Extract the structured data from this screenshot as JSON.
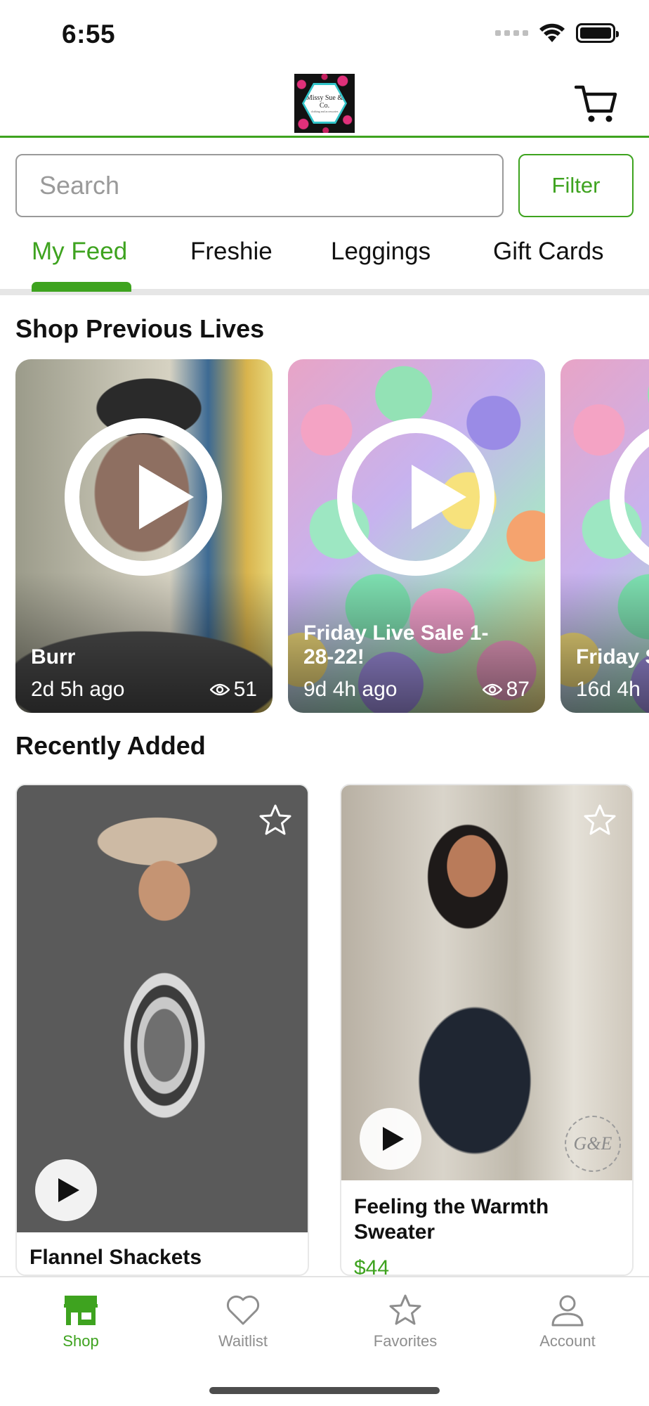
{
  "status_bar": {
    "time": "6:55"
  },
  "header": {
    "logo_text": "Missy Sue & Co.",
    "logo_subtext": "clothing and accessories"
  },
  "search": {
    "placeholder": "Search",
    "value": ""
  },
  "filter_label": "Filter",
  "tabs": [
    {
      "label": "My Feed",
      "active": true
    },
    {
      "label": "Freshie",
      "active": false
    },
    {
      "label": "Leggings",
      "active": false
    },
    {
      "label": "Gift Cards",
      "active": false
    }
  ],
  "previous_lives": {
    "title": "Shop Previous Lives",
    "items": [
      {
        "title": "Burr",
        "time_ago": "2d 5h ago",
        "views": "51"
      },
      {
        "title": "Friday Live Sale 1-28-22!",
        "time_ago": "9d 4h ago",
        "views": "87"
      },
      {
        "title": "Friday Sale!",
        "time_ago": "16d 4h"
      }
    ]
  },
  "recently_added": {
    "title": "Recently Added",
    "items": [
      {
        "name": "Flannel Shackets",
        "price": ""
      },
      {
        "name": "Feeling the Warmth Sweater",
        "price": "$44",
        "watermark": "G&E"
      }
    ]
  },
  "bottom_nav": [
    {
      "label": "Shop",
      "icon": "shop-icon",
      "active": true
    },
    {
      "label": "Waitlist",
      "icon": "heart-icon",
      "active": false
    },
    {
      "label": "Favorites",
      "icon": "star-icon",
      "active": false
    },
    {
      "label": "Account",
      "icon": "person-icon",
      "active": false
    }
  ],
  "colors": {
    "accent": "#3ea31f",
    "inactive": "#8e8e8e",
    "divider": "#e6e6e6"
  }
}
